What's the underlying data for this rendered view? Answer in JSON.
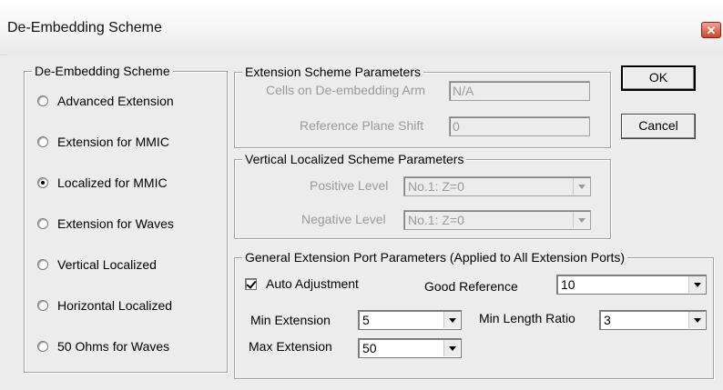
{
  "window": {
    "title": "De-Embedding Scheme",
    "close_glyph": "✕"
  },
  "scheme_group": {
    "legend": "De-Embedding Scheme",
    "options": [
      {
        "label": "Advanced Extension",
        "checked": false
      },
      {
        "label": "Extension for MMIC",
        "checked": false
      },
      {
        "label": "Localized for MMIC",
        "checked": true
      },
      {
        "label": "Extension for Waves",
        "checked": false
      },
      {
        "label": "Vertical Localized",
        "checked": false
      },
      {
        "label": "Horizontal Localized",
        "checked": false
      },
      {
        "label": "50 Ohms for Waves",
        "checked": false
      }
    ]
  },
  "extension_params": {
    "legend": "Extension Scheme Parameters",
    "cells_label": "Cells on De-embedding Arm",
    "cells_value": "N/A",
    "shift_label": "Reference Plane Shift",
    "shift_value": "0"
  },
  "vertical_params": {
    "legend": "Vertical Localized Scheme Parameters",
    "positive_label": "Positive Level",
    "positive_value": "No.1: Z=0",
    "negative_label": "Negative Level",
    "negative_value": "No.1: Z=0"
  },
  "general_params": {
    "legend": "General Extension Port Parameters (Applied to All Extension Ports)",
    "auto_adjust_label": "Auto Adjustment",
    "auto_adjust_checked": true,
    "good_ref_label": "Good Reference",
    "good_ref_value": "10",
    "min_ext_label": "Min Extension",
    "min_ext_value": "5",
    "min_len_label": "Min Length Ratio",
    "min_len_value": "3",
    "max_ext_label": "Max Extension",
    "max_ext_value": "50"
  },
  "buttons": {
    "ok": "OK",
    "cancel": "Cancel"
  }
}
